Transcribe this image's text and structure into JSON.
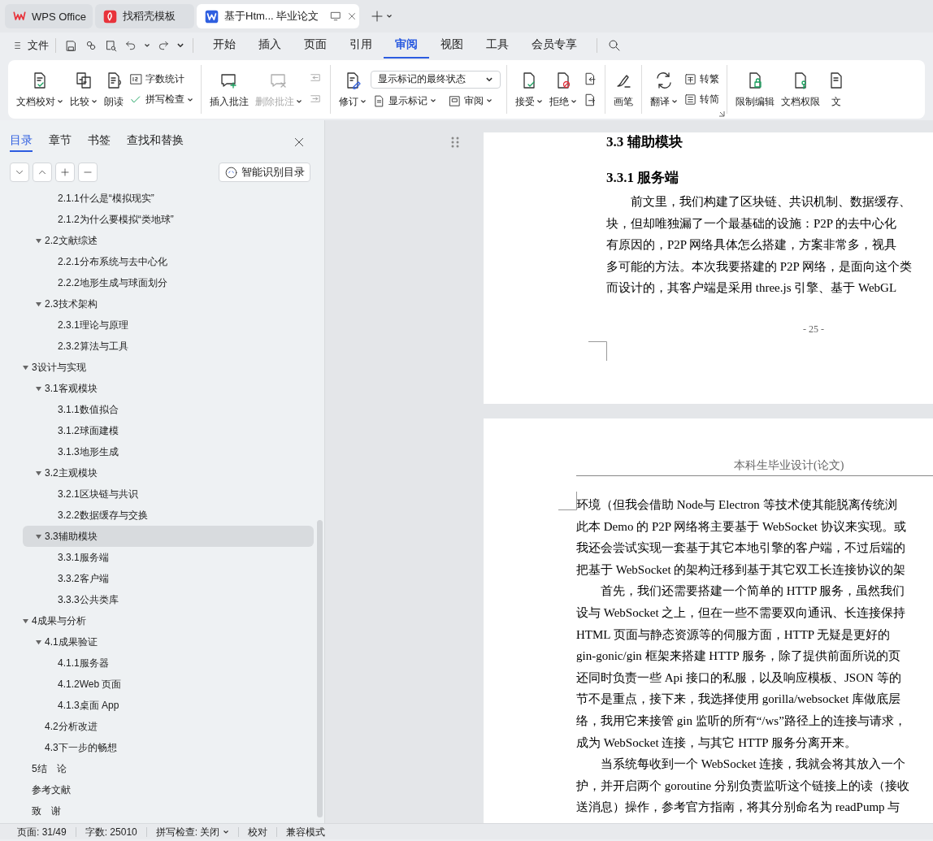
{
  "tabs": [
    {
      "label": "WPS Office",
      "kind": "wps",
      "selected": false
    },
    {
      "label": "找稻壳模板",
      "kind": "docer",
      "selected": false
    },
    {
      "label": "基于Htm... 毕业论文",
      "kind": "doc",
      "selected": true
    }
  ],
  "menu": {
    "file": "文件",
    "items": [
      {
        "label": "开始",
        "selected": false
      },
      {
        "label": "插入",
        "selected": false
      },
      {
        "label": "页面",
        "selected": false
      },
      {
        "label": "引用",
        "selected": false
      },
      {
        "label": "审阅",
        "selected": true
      },
      {
        "label": "视图",
        "selected": false
      },
      {
        "label": "工具",
        "selected": false
      },
      {
        "label": "会员专享",
        "selected": false
      }
    ]
  },
  "ribbon": {
    "groups": [
      {
        "items": [
          {
            "kind": "large",
            "label": "文档校对",
            "menu": true,
            "disabled": false
          },
          {
            "kind": "large",
            "label": "比较",
            "menu": true,
            "disabled": false
          },
          {
            "kind": "large",
            "label": "朗读",
            "menu": false,
            "disabled": false
          },
          {
            "kind": "small",
            "label": "字数统计",
            "menu": false,
            "disabled": false
          },
          {
            "kind": "small",
            "label": "拼写检查",
            "menu": true,
            "disabled": false
          }
        ]
      },
      {
        "items": [
          {
            "kind": "large",
            "label": "插入批注",
            "menu": false,
            "disabled": false
          },
          {
            "kind": "large",
            "label": "删除批注",
            "menu": true,
            "disabled": true
          },
          {
            "kind": "icon",
            "disabled": true
          },
          {
            "kind": "icon",
            "disabled": true
          }
        ]
      },
      {
        "items": [
          {
            "kind": "large",
            "label": "修订",
            "menu": true,
            "disabled": false
          },
          {
            "kind": "dropdown",
            "label": "显示标记的最终状态",
            "menu": true,
            "disabled": false
          },
          {
            "kind": "small",
            "label": "显示标记",
            "menu": true,
            "disabled": false
          },
          {
            "kind": "small",
            "label": "审阅",
            "menu": true,
            "disabled": false
          }
        ]
      },
      {
        "items": [
          {
            "kind": "large",
            "label": "接受",
            "menu": true,
            "disabled": false
          },
          {
            "kind": "large",
            "label": "拒绝",
            "menu": true,
            "disabled": false
          },
          {
            "kind": "icon",
            "disabled": false
          },
          {
            "kind": "icon",
            "disabled": false
          }
        ]
      },
      {
        "items": [
          {
            "kind": "large",
            "label": "画笔",
            "menu": false,
            "disabled": false
          }
        ]
      },
      {
        "launcher": true,
        "items": [
          {
            "kind": "large",
            "label": "翻译",
            "menu": true,
            "disabled": false
          },
          {
            "kind": "small",
            "label": "转繁",
            "menu": false,
            "disabled": false
          },
          {
            "kind": "small",
            "label": "转简",
            "menu": false,
            "disabled": false
          }
        ]
      },
      {
        "items": [
          {
            "kind": "large",
            "label": "限制编辑",
            "menu": false,
            "disabled": false
          },
          {
            "kind": "large",
            "label": "文档权限",
            "menu": false,
            "disabled": false
          },
          {
            "kind": "large",
            "label": "文",
            "menu": false,
            "disabled": false
          }
        ]
      }
    ]
  },
  "toc": {
    "tabs": [
      {
        "label": "目录",
        "selected": true
      },
      {
        "label": "章节",
        "selected": false
      },
      {
        "label": "书签",
        "selected": false
      },
      {
        "label": "查找和替换",
        "selected": false
      }
    ],
    "smart_button": "智能识别目录",
    "items": [
      {
        "children": [
          {
            "children": [
              {
                "label": "2.1.1什么是“模拟现实”",
                "selected": false
              },
              {
                "label": "2.1.2为什么要模拟“类地球”",
                "selected": false
              }
            ]
          },
          {
            "label": "2.2文献综述",
            "selected": false,
            "expanded": true,
            "children": [
              {
                "label": "2.2.1分布系统与去中心化",
                "selected": false
              },
              {
                "label": "2.2.2地形生成与球面划分",
                "selected": false
              }
            ]
          },
          {
            "label": "2.3技术架构",
            "selected": false,
            "expanded": true,
            "children": [
              {
                "label": "2.3.1理论与原理",
                "selected": false
              },
              {
                "label": "2.3.2算法与工具",
                "selected": false
              }
            ]
          }
        ]
      },
      {
        "label": "3设计与实现",
        "selected": false,
        "expanded": true,
        "children": [
          {
            "label": "3.1客观模块",
            "selected": false,
            "expanded": true,
            "children": [
              {
                "label": "3.1.1数值拟合",
                "selected": false
              },
              {
                "label": "3.1.2球面建模",
                "selected": false
              },
              {
                "label": "3.1.3地形生成",
                "selected": false
              }
            ]
          },
          {
            "label": "3.2主观模块",
            "selected": false,
            "expanded": true,
            "children": [
              {
                "label": "3.2.1区块链与共识",
                "selected": false
              },
              {
                "label": "3.2.2数据缓存与交换",
                "selected": false
              }
            ]
          },
          {
            "label": "3.3辅助模块",
            "selected": true,
            "expanded": true,
            "children": [
              {
                "label": "3.3.1服务端",
                "selected": false
              },
              {
                "label": "3.3.2客户端",
                "selected": false
              },
              {
                "label": "3.3.3公共类库",
                "selected": false
              }
            ]
          }
        ]
      },
      {
        "label": "4成果与分析",
        "selected": false,
        "expanded": true,
        "children": [
          {
            "label": "4.1成果验证",
            "selected": false,
            "expanded": true,
            "children": [
              {
                "label": "4.1.1服务器",
                "selected": false
              },
              {
                "label": "4.1.2Web 页面",
                "selected": false
              },
              {
                "label": "4.1.3桌面 App",
                "selected": false
              }
            ]
          },
          {
            "label": "4.2分析改进",
            "selected": false
          },
          {
            "label": "4.3下一步的畅想",
            "selected": false
          }
        ]
      },
      {
        "label": "5结　论",
        "selected": false
      },
      {
        "label": "参考文献",
        "selected": false
      },
      {
        "label": "致　谢",
        "selected": false
      }
    ]
  },
  "document": {
    "pages": [
      {
        "blocks": [
          {
            "kind": "heading",
            "text": "3.3  辅助模块"
          },
          {
            "kind": "subheading",
            "text": "3.3.1  服务端"
          },
          {
            "kind": "paragraph",
            "continued": false,
            "lines": [
              "前文里，我们构建了区块链、共识机制、数据缓存、",
              "块，但却唯独漏了一个最基础的设施：P2P 的去中心化",
              "有原因的，P2P 网络具体怎么搭建，方案非常多，视具",
              "多可能的方法。本次我要搭建的 P2P 网络，是面向这个类",
              "而设计的，其客户端是采用 three.js 引擎、基于 WebGL"
            ]
          }
        ],
        "page_number": "- 25 -"
      },
      {
        "header": "本科生毕业设计(论文)",
        "blocks": [
          {
            "kind": "paragraph",
            "continued": true,
            "lines": [
              "环境（但我会借助 Node与 Electron 等技术使其能脱离传统浏",
              "此本 Demo 的 P2P 网络将主要基于 WebSocket 协议来实现。或",
              "我还会尝试实现一套基于其它本地引擎的客户端，不过后端的",
              "把基于 WebSocket 的架构迁移到基于其它双工长连接协议的架"
            ]
          },
          {
            "kind": "paragraph",
            "continued": false,
            "lines": [
              "首先，我们还需要搭建一个简单的 HTTP 服务，虽然我们",
              "设与 WebSocket 之上，但在一些不需要双向通讯、长连接保持",
              "HTML 页面与静态资源等的伺服方面，HTTP 无疑是更好的",
              "gin-gonic/gin 框架来搭建 HTTP 服务，除了提供前面所说的页",
              "还同时负责一些 Api 接口的私服，以及响应模板、JSON 等的",
              "节不是重点，接下来，我选择使用 gorilla/websocket 库做底层",
              "络，我用它来接管 gin 监听的所有“/ws”路径上的连接与请求，",
              "成为 WebSocket 连接，与其它 HTTP 服务分离开来。"
            ]
          },
          {
            "kind": "paragraph",
            "continued": false,
            "lines": [
              "当系统每收到一个 WebSocket 连接，我就会将其放入一个",
              "护，并开启两个 goroutine 分别负责监听这个链接上的读（接收",
              "送消息）操作，参考官方指南，将其分别命名为 readPump 与"
            ]
          }
        ]
      }
    ]
  },
  "status_bar": [
    {
      "label": "页面: 31/49",
      "menu": false
    },
    {
      "label": "字数: 25010",
      "menu": false
    },
    {
      "label": "拼写检查: 关闭",
      "menu": true
    },
    {
      "label": "校对",
      "menu": false
    },
    {
      "label": "兼容模式",
      "menu": false
    }
  ]
}
